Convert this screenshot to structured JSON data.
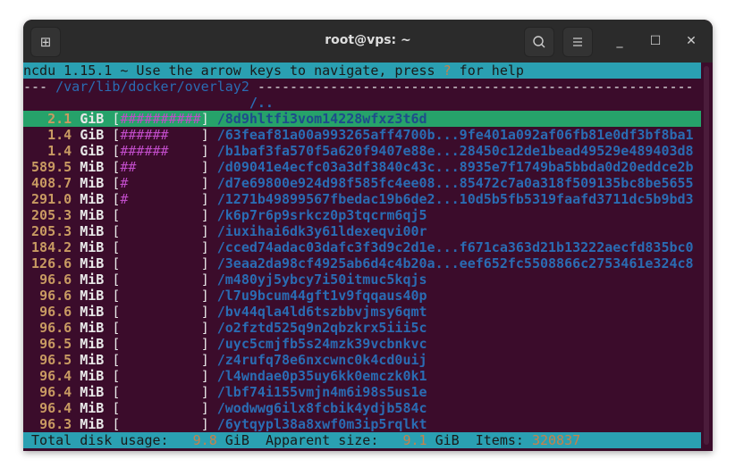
{
  "window": {
    "title": "root@vps: ~",
    "icons": {
      "new_tab": "new-tab-icon",
      "search": "search-icon",
      "menu": "hamburger-menu-icon",
      "minimize": "minimize-icon",
      "maximize": "maximize-icon",
      "close": "close-icon"
    }
  },
  "ncdu": {
    "header_prefix": "ncdu 1.15.1 ~ Use the arrow keys to navigate, press ",
    "header_key": "?",
    "header_suffix": " for help",
    "path_prefix": "--- ",
    "path": "/var/lib/docker/overlay2",
    "path_suffix": " ------------------------------------------------------",
    "parent": "/..",
    "rows": [
      {
        "size": "2.1",
        "unit": "GiB",
        "bar": "##########",
        "name": "/8d9hltfi3vom14228wfxz3t6d",
        "selected": true
      },
      {
        "size": "1.4",
        "unit": "GiB",
        "bar": "######",
        "name": "/63feaf81a00a993265aff4700b...9fe401a092af06fb81e0df3bf8ba1"
      },
      {
        "size": "1.4",
        "unit": "GiB",
        "bar": "######",
        "name": "/b1baf3fa570f5a620f9407e88e...28450c12de1bead49529e489403d8"
      },
      {
        "size": "589.5",
        "unit": "MiB",
        "bar": "##",
        "name": "/d09041e4ecfc03a3df3840c43c...8935e7f1749ba5bbda0d20eddce2b"
      },
      {
        "size": "408.7",
        "unit": "MiB",
        "bar": "#",
        "name": "/d7e69800e924d98f585fc4ee08...85472c7a0a318f509135bc8be5655"
      },
      {
        "size": "291.0",
        "unit": "MiB",
        "bar": "#",
        "name": "/1271b49899567fbedac19b6de2...10d5b5fb5319faafd3711dc5b9bd3"
      },
      {
        "size": "205.3",
        "unit": "MiB",
        "bar": "",
        "name": "/k6p7r6p9srkcz0p3tqcrm6qj5"
      },
      {
        "size": "205.3",
        "unit": "MiB",
        "bar": "",
        "name": "/iuxihai6dk3y61ldexeqvi00r"
      },
      {
        "size": "184.2",
        "unit": "MiB",
        "bar": "",
        "name": "/cced74adac03dafc3f3d9c2d1e...f671ca363d21b13222aecfd835bc0"
      },
      {
        "size": "126.6",
        "unit": "MiB",
        "bar": "",
        "name": "/3eaa2da98cf4925ab6d4c4b20a...eef652fc5508866c2753461e324c8"
      },
      {
        "size": "96.6",
        "unit": "MiB",
        "bar": "",
        "name": "/m480yj5ybcy7i50itmuc5kqjs"
      },
      {
        "size": "96.6",
        "unit": "MiB",
        "bar": "",
        "name": "/l7u9bcum44gft1v9fqqaus40p"
      },
      {
        "size": "96.6",
        "unit": "MiB",
        "bar": "",
        "name": "/bv44qla4ld6tszbbvjmsy6qmt"
      },
      {
        "size": "96.6",
        "unit": "MiB",
        "bar": "",
        "name": "/o2fztd525q9n2qbzkrx5iii5c"
      },
      {
        "size": "96.5",
        "unit": "MiB",
        "bar": "",
        "name": "/uyc5cmjfb5s24mzk39vcbnkvc"
      },
      {
        "size": "96.5",
        "unit": "MiB",
        "bar": "",
        "name": "/z4rufq78e6nxcwnc0k4cd0uij"
      },
      {
        "size": "96.4",
        "unit": "MiB",
        "bar": "",
        "name": "/l4wndae0p35uy6kk0emczk0k1"
      },
      {
        "size": "96.4",
        "unit": "MiB",
        "bar": "",
        "name": "/lbf74i155vmjn4m6i98s5us1e"
      },
      {
        "size": "96.4",
        "unit": "MiB",
        "bar": "",
        "name": "/wodwwg6ilx8fcbik4ydjb584c"
      },
      {
        "size": "96.3",
        "unit": "MiB",
        "bar": "",
        "name": "/6ytqypl38a8xwf0m3ip5rqlkt"
      }
    ],
    "footer": {
      "total_label": " Total disk usage:   ",
      "total_value": "9.8",
      "total_unit": " GiB  ",
      "apparent_label": "Apparent size:   ",
      "apparent_value": "9.1",
      "apparent_unit": " GiB  ",
      "items_label": "Items: ",
      "items_value": "320837"
    }
  },
  "colors": {
    "background": "#3b0c2b",
    "header_bar": "#2aa0b2",
    "selection": "#26a26a",
    "names": "#2a6cb3",
    "bars": "#c04cc8"
  }
}
